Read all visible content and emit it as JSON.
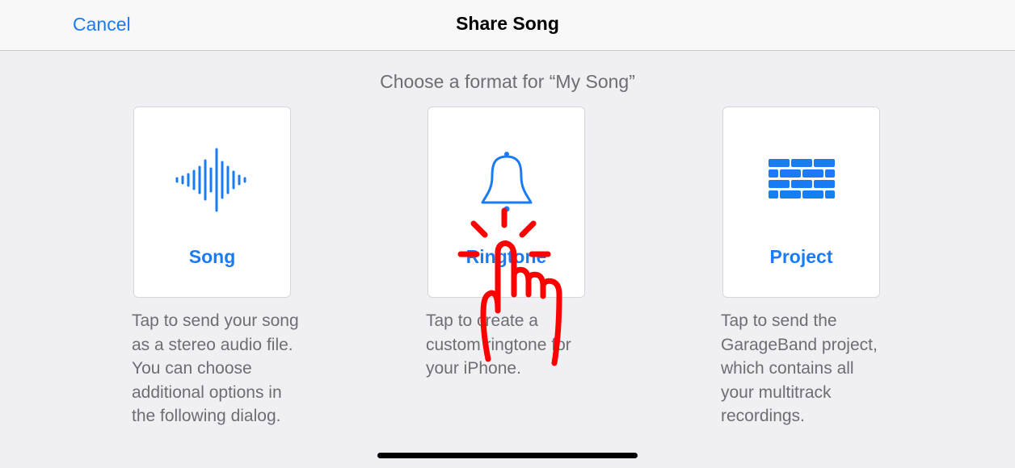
{
  "navbar": {
    "cancel_label": "Cancel",
    "title": "Share Song"
  },
  "subtitle": "Choose a format for “My Song”",
  "options": [
    {
      "label": "Song",
      "icon": "waveform-icon",
      "description": "Tap to send your song as a stereo audio file. You can choose additional options in the following dialog."
    },
    {
      "label": "Ringtone",
      "icon": "bell-icon",
      "description": "Tap to create a custom ringtone for your iPhone."
    },
    {
      "label": "Project",
      "icon": "brick-wall-icon",
      "description": "Tap to send the GarageBand project, which contains all your multitrack recordings."
    }
  ],
  "overlay": {
    "icon": "tap-gesture-icon",
    "color": "#ff0000"
  },
  "colors": {
    "accent": "#1a7cf4",
    "background": "#efeff4",
    "secondary_text": "#6d6d72"
  }
}
